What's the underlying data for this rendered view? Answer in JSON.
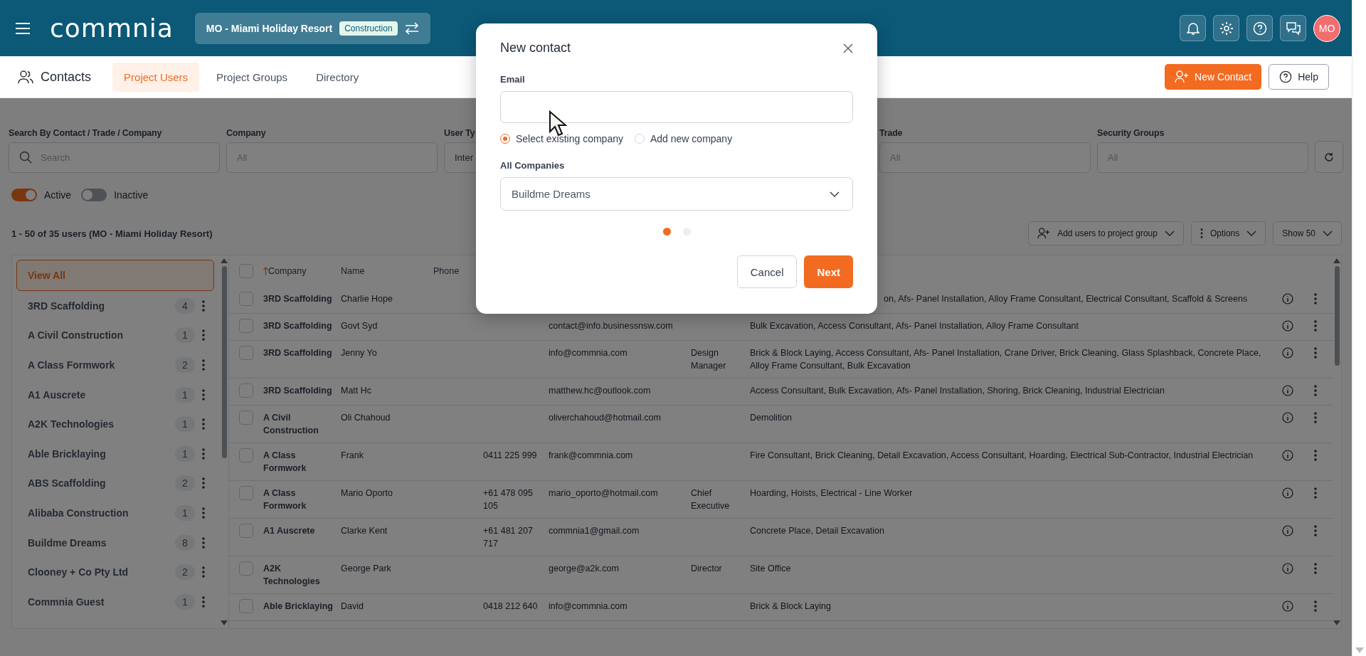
{
  "top_bar": {
    "logo": "commnia",
    "project": {
      "name": "MO - Miami Holiday Resort",
      "badge": "Construction"
    },
    "avatar": "MO"
  },
  "sub_nav": {
    "title": "Contacts",
    "tabs": [
      {
        "label": "Project Users",
        "selected": true
      },
      {
        "label": "Project Groups",
        "selected": false
      },
      {
        "label": "Directory",
        "selected": false
      }
    ],
    "new_contact_button": "New Contact",
    "help_button": "Help"
  },
  "filters": [
    {
      "kind": "search",
      "label": "Search By Contact / Trade / Company",
      "placeholder": "Search"
    },
    {
      "kind": "select",
      "label": "Company",
      "placeholder": "All"
    },
    {
      "kind": "select",
      "label": "User Ty",
      "value": "Inter"
    },
    {
      "kind": "select",
      "label": "Trade",
      "placeholder": "All"
    },
    {
      "kind": "select",
      "label": "Security Groups",
      "placeholder": "All"
    }
  ],
  "status_toggles": [
    {
      "label": "Active",
      "on": true
    },
    {
      "label": "Inactive",
      "on": false
    }
  ],
  "summary": "1 - 50 of 35 users (MO - Miami Holiday Resort)",
  "toolbar": {
    "add_to_group": "Add users to project group",
    "options": "Options",
    "page_size": "Show 50"
  },
  "sidebar": {
    "items": [
      {
        "label": "View All",
        "selected": true
      },
      {
        "label": "3RD Scaffolding",
        "count": "4",
        "selected": false
      },
      {
        "label": "A Civil Construction",
        "count": "1",
        "selected": false
      },
      {
        "label": "A Class Formwork",
        "count": "2",
        "selected": false
      },
      {
        "label": "A1 Auscrete",
        "count": "1",
        "selected": false
      },
      {
        "label": "A2K Technologies",
        "count": "1",
        "selected": false
      },
      {
        "label": "Able Bricklaying",
        "count": "1",
        "selected": false
      },
      {
        "label": "ABS Scaffolding",
        "count": "2",
        "selected": false
      },
      {
        "label": "Alibaba Construction",
        "count": "1",
        "selected": false
      },
      {
        "label": "Buildme Dreams",
        "count": "8",
        "selected": false
      },
      {
        "label": "Clooney + Co Pty Ltd",
        "count": "2",
        "selected": false
      },
      {
        "label": "Commnia Guest",
        "count": "1",
        "selected": false
      }
    ]
  },
  "table": {
    "select_all": {
      "checked": false
    },
    "columns": [
      "Company",
      "Name",
      "Phone"
    ],
    "rows": [
      {
        "checked": false,
        "company": "3RD Scaffolding",
        "name": "Charlie Hope",
        "trades": "on, Afs- Panel Installation, Alloy Frame Consultant, Electrical Consultant, Scaffold & Screens"
      },
      {
        "checked": false,
        "company": "3RD Scaffolding",
        "name": "Govt Syd",
        "email": "contact@info.businessnsw.com",
        "trades": "Bulk Excavation, Access Consultant, Afs- Panel Installation, Alloy Frame Consultant"
      },
      {
        "checked": false,
        "company": "3RD Scaffolding",
        "name": "Jenny Yo",
        "email": "info@commnia.com",
        "title": "Design Manager",
        "trades": "Brick & Block Laying, Access Consultant, Afs- Panel Installation, Crane Driver, Brick Cleaning, Glass Splashback, Concrete Place, Alloy Frame Consultant, Bulk Excavation"
      },
      {
        "checked": false,
        "company": "3RD Scaffolding",
        "name": "Matt Hc",
        "email": "matthew.hc@outlook.com",
        "trades": "Access Consultant, Bulk Excavation, Afs- Panel Installation, Shoring, Brick Cleaning, Industrial Electrician"
      },
      {
        "checked": false,
        "company": "A Civil Construction",
        "name": "Oli Chahoud",
        "email": "oliverchahoud@hotmail.com",
        "trades": "Demolition"
      },
      {
        "checked": false,
        "company": "A Class Formwork",
        "name": "Frank",
        "phone": "0411 225 999",
        "email": "frank@commnia.com",
        "trades": "Fire Consultant, Brick Cleaning, Detail Excavation, Access Consultant, Hoarding, Electrical Sub-Contractor, Industrial Electrician"
      },
      {
        "checked": false,
        "company": "A Class Formwork",
        "name": "Mario Oporto",
        "phone": "+61 478 095 105",
        "email": "mario_oporto@hotmail.com",
        "title": "Chief Executive",
        "trades": "Hoarding, Hoists, Electrical - Line Worker"
      },
      {
        "checked": false,
        "company": "A1 Auscrete",
        "name": "Clarke Kent",
        "phone": "+61 481 207 717",
        "email": "commnia1@gmail.com",
        "trades": "Concrete Place, Detail Excavation"
      },
      {
        "checked": false,
        "company": "A2K Technologies",
        "name": "George Park",
        "email": "george@a2k.com",
        "title": "Director",
        "trades": "Site Office"
      },
      {
        "checked": false,
        "company": "Able Bricklaying",
        "name": "David",
        "phone": "0418 212 640",
        "email": "info@commnia.com",
        "trades": "Brick & Block Laying"
      }
    ]
  },
  "dialog": {
    "title": "New contact",
    "email_label": "Email",
    "company_options": [
      {
        "label": "Select existing company",
        "selected": true
      },
      {
        "label": "Add new company",
        "selected": false
      }
    ],
    "companies_label": "All Companies",
    "company_value": "Buildme Dreams",
    "steps": [
      {
        "selected": true
      },
      {
        "selected": false
      }
    ],
    "cancel_button": "Cancel",
    "next_button": "Next"
  }
}
